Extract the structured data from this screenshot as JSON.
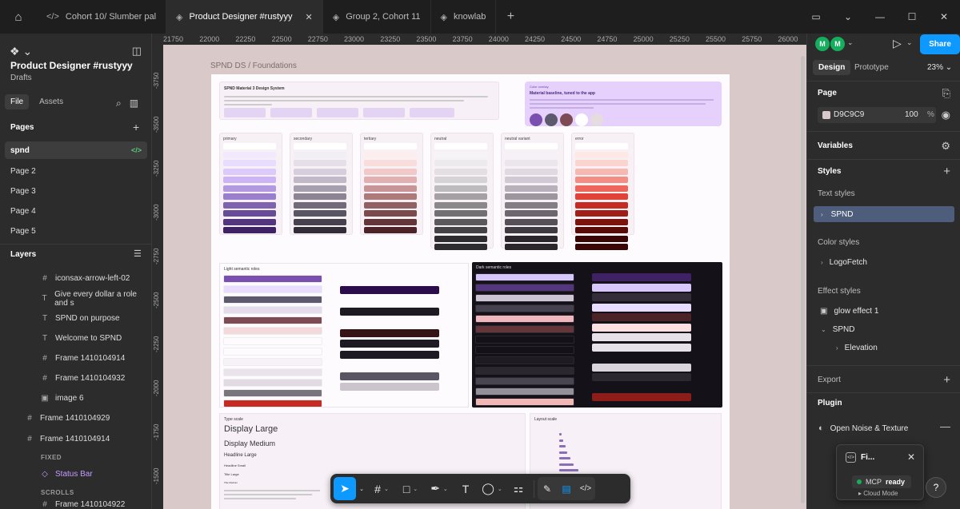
{
  "tabs": [
    {
      "label": "Cohort 10/ Slumber pal",
      "icon": "</>",
      "active": false
    },
    {
      "label": "Product Designer #rustyyy",
      "icon": "◈",
      "active": true
    },
    {
      "label": "Group 2, Cohort 11",
      "icon": "◈",
      "active": false
    },
    {
      "label": "knowlab",
      "icon": "◈",
      "active": false
    }
  ],
  "left": {
    "project_name": "Product Designer #rustyyy",
    "project_location": "Drafts",
    "file_tab": "File",
    "assets_tab": "Assets",
    "pages_title": "Pages",
    "pages": [
      "spnd",
      "Page 2",
      "Page 3",
      "Page 4",
      "Page 5"
    ],
    "layers_title": "Layers",
    "layers": [
      {
        "name": "iconsax-arrow-left-02",
        "icon": "#"
      },
      {
        "name": "Give every dollar a role and s",
        "icon": "T"
      },
      {
        "name": "SPND on purpose",
        "icon": "T"
      },
      {
        "name": "Welcome to SPND",
        "icon": "T"
      },
      {
        "name": "Frame 1410104914",
        "icon": "#"
      },
      {
        "name": "Frame 1410104932",
        "icon": "#"
      },
      {
        "name": "image 6",
        "icon": "▣"
      },
      {
        "name": "Frame 1410104929",
        "icon": "#"
      },
      {
        "name": "Frame 1410104914",
        "icon": "#"
      }
    ],
    "fixed_label": "FIXED",
    "status_bar": "Status Bar",
    "scrolls_label": "SCROLLS",
    "last_layer": "Frame 1410104922"
  },
  "ruler": [
    "21750",
    "22000",
    "22250",
    "22500",
    "22750",
    "23000",
    "23250",
    "23500",
    "23750",
    "24000",
    "24250",
    "24500",
    "24750",
    "25000",
    "25250",
    "25500",
    "25750",
    "26000"
  ],
  "ruler_left": [
    "-3750",
    "-3500",
    "-3250",
    "-3000",
    "-2750",
    "-2500",
    "-2250",
    "-2000",
    "-1750",
    "-1500"
  ],
  "canvas": {
    "frame_label": "SPND DS / Foundations",
    "intro_title": "SPND Material 3 Design System",
    "hero_label": "Color overlay",
    "hero_title": "Material baseline, tuned to the app",
    "palettes": [
      "primary",
      "secondary",
      "tertiary",
      "neutral",
      "neutral variant",
      "error"
    ],
    "light_title": "Light semantic roles",
    "dark_title": "Dark semantic roles",
    "type_title": "Type scale",
    "type_samples": [
      "Display Large",
      "Display Medium",
      "Headline Large",
      "Headline Small",
      "Title Large",
      "Title Medium"
    ],
    "layout_title": "Layout scale"
  },
  "right": {
    "avatar": "M",
    "share": "Share",
    "design_tab": "Design",
    "prototype_tab": "Prototype",
    "zoom": "23%",
    "page_title": "Page",
    "page_color": "D9C9C9",
    "page_opacity": "100",
    "page_pct": "%",
    "variables": "Variables",
    "styles": "Styles",
    "text_styles": "Text styles",
    "text_style_item": "SPND",
    "color_styles": "Color styles",
    "color_style_item": "LogoFetch",
    "effect_styles": "Effect styles",
    "effect_item_1": "glow effect 1",
    "effect_item_2": "SPND",
    "effect_item_3": "Elevation",
    "export": "Export",
    "plugin": "Plugin",
    "plugin_name": "Open Noise & Texture",
    "popup_title": "Fi...",
    "mcp_label": "MCP",
    "mcp_status": "ready",
    "cloud_mode": "Cloud Mode"
  }
}
